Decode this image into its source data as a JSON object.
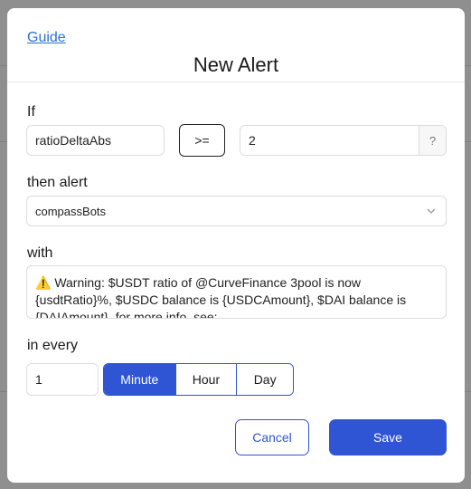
{
  "modal": {
    "guide_link": "Guide",
    "title": "New Alert"
  },
  "condition": {
    "label": "If",
    "metric_value": "ratioDeltaAbs",
    "operator_label": ">=",
    "threshold_value": "2",
    "help_label": "?"
  },
  "then_alert": {
    "label": "then alert",
    "selected_value": "compassBots"
  },
  "message": {
    "label": "with",
    "warning_glyph": "⚠️",
    "text": "Warning: $USDT ratio of @CurveFinance 3pool is now {usdtRatio}%, $USDC balance is {USDCAmount}, $DAI balance is {DAIAmount}, for more info, see:"
  },
  "interval": {
    "label": "in every",
    "value": "1",
    "units": [
      "Minute",
      "Hour",
      "Day"
    ],
    "selected_unit": "Minute"
  },
  "actions": {
    "cancel_label": "Cancel",
    "save_label": "Save"
  },
  "colors": {
    "accent": "#2f55d4",
    "link": "#2a6fd6",
    "overlay": "#8f8f8f"
  }
}
